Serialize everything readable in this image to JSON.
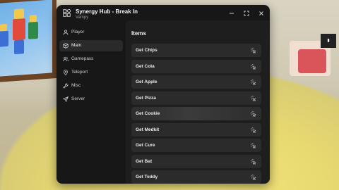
{
  "window": {
    "title": "Synergy Hub - Break In",
    "subtitle": "Vampy",
    "controls": {
      "minimize_icon": "minimize-icon",
      "maximize_icon": "maximize-icon",
      "close_icon": "close-icon"
    }
  },
  "sidebar": {
    "items": [
      {
        "label": "Player",
        "icon": "user-icon"
      },
      {
        "label": "Main",
        "icon": "cube-icon",
        "active": true
      },
      {
        "label": "Gamepass",
        "icon": "users-icon"
      },
      {
        "label": "Teleport",
        "icon": "map-pin-icon"
      },
      {
        "label": "Misc",
        "icon": "wrench-icon"
      },
      {
        "label": "Server",
        "icon": "send-icon"
      }
    ]
  },
  "main": {
    "section_title": "Items",
    "buttons": [
      {
        "label": "Get Chips",
        "icon": "click-icon"
      },
      {
        "label": "Get Cola",
        "icon": "click-icon"
      },
      {
        "label": "Get Apple",
        "icon": "click-icon"
      },
      {
        "label": "Get Pizza",
        "icon": "click-icon"
      },
      {
        "label": "Get Cookie",
        "icon": "click-icon",
        "hovered": true
      },
      {
        "label": "Get Medkit",
        "icon": "click-icon"
      },
      {
        "label": "Get Cure",
        "icon": "click-icon"
      },
      {
        "label": "Get Bat",
        "icon": "click-icon"
      },
      {
        "label": "Get Teddy",
        "icon": "click-icon"
      }
    ]
  },
  "colors": {
    "window_bg": "#171717",
    "content_bg": "#1e1e1e",
    "button_bg": "#2b2b2b",
    "active_nav_bg": "#2a2a2a",
    "text": "#ececec"
  }
}
